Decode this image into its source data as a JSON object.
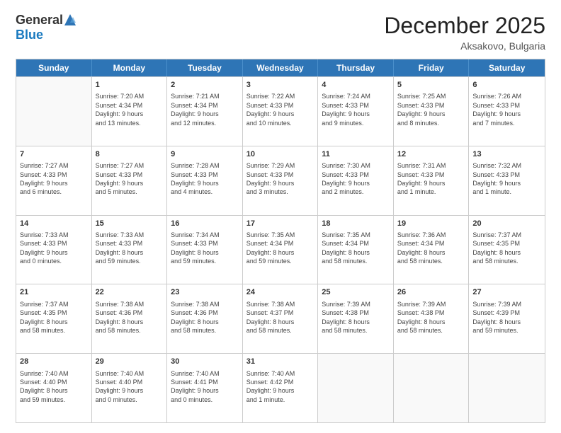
{
  "header": {
    "logo_general": "General",
    "logo_blue": "Blue",
    "month_title": "December 2025",
    "location": "Aksakovo, Bulgaria"
  },
  "weekdays": [
    "Sunday",
    "Monday",
    "Tuesday",
    "Wednesday",
    "Thursday",
    "Friday",
    "Saturday"
  ],
  "rows": [
    [
      {
        "day": "",
        "info": ""
      },
      {
        "day": "1",
        "info": "Sunrise: 7:20 AM\nSunset: 4:34 PM\nDaylight: 9 hours\nand 13 minutes."
      },
      {
        "day": "2",
        "info": "Sunrise: 7:21 AM\nSunset: 4:34 PM\nDaylight: 9 hours\nand 12 minutes."
      },
      {
        "day": "3",
        "info": "Sunrise: 7:22 AM\nSunset: 4:33 PM\nDaylight: 9 hours\nand 10 minutes."
      },
      {
        "day": "4",
        "info": "Sunrise: 7:24 AM\nSunset: 4:33 PM\nDaylight: 9 hours\nand 9 minutes."
      },
      {
        "day": "5",
        "info": "Sunrise: 7:25 AM\nSunset: 4:33 PM\nDaylight: 9 hours\nand 8 minutes."
      },
      {
        "day": "6",
        "info": "Sunrise: 7:26 AM\nSunset: 4:33 PM\nDaylight: 9 hours\nand 7 minutes."
      }
    ],
    [
      {
        "day": "7",
        "info": "Sunrise: 7:27 AM\nSunset: 4:33 PM\nDaylight: 9 hours\nand 6 minutes."
      },
      {
        "day": "8",
        "info": "Sunrise: 7:27 AM\nSunset: 4:33 PM\nDaylight: 9 hours\nand 5 minutes."
      },
      {
        "day": "9",
        "info": "Sunrise: 7:28 AM\nSunset: 4:33 PM\nDaylight: 9 hours\nand 4 minutes."
      },
      {
        "day": "10",
        "info": "Sunrise: 7:29 AM\nSunset: 4:33 PM\nDaylight: 9 hours\nand 3 minutes."
      },
      {
        "day": "11",
        "info": "Sunrise: 7:30 AM\nSunset: 4:33 PM\nDaylight: 9 hours\nand 2 minutes."
      },
      {
        "day": "12",
        "info": "Sunrise: 7:31 AM\nSunset: 4:33 PM\nDaylight: 9 hours\nand 1 minute."
      },
      {
        "day": "13",
        "info": "Sunrise: 7:32 AM\nSunset: 4:33 PM\nDaylight: 9 hours\nand 1 minute."
      }
    ],
    [
      {
        "day": "14",
        "info": "Sunrise: 7:33 AM\nSunset: 4:33 PM\nDaylight: 9 hours\nand 0 minutes."
      },
      {
        "day": "15",
        "info": "Sunrise: 7:33 AM\nSunset: 4:33 PM\nDaylight: 8 hours\nand 59 minutes."
      },
      {
        "day": "16",
        "info": "Sunrise: 7:34 AM\nSunset: 4:33 PM\nDaylight: 8 hours\nand 59 minutes."
      },
      {
        "day": "17",
        "info": "Sunrise: 7:35 AM\nSunset: 4:34 PM\nDaylight: 8 hours\nand 59 minutes."
      },
      {
        "day": "18",
        "info": "Sunrise: 7:35 AM\nSunset: 4:34 PM\nDaylight: 8 hours\nand 58 minutes."
      },
      {
        "day": "19",
        "info": "Sunrise: 7:36 AM\nSunset: 4:34 PM\nDaylight: 8 hours\nand 58 minutes."
      },
      {
        "day": "20",
        "info": "Sunrise: 7:37 AM\nSunset: 4:35 PM\nDaylight: 8 hours\nand 58 minutes."
      }
    ],
    [
      {
        "day": "21",
        "info": "Sunrise: 7:37 AM\nSunset: 4:35 PM\nDaylight: 8 hours\nand 58 minutes."
      },
      {
        "day": "22",
        "info": "Sunrise: 7:38 AM\nSunset: 4:36 PM\nDaylight: 8 hours\nand 58 minutes."
      },
      {
        "day": "23",
        "info": "Sunrise: 7:38 AM\nSunset: 4:36 PM\nDaylight: 8 hours\nand 58 minutes."
      },
      {
        "day": "24",
        "info": "Sunrise: 7:38 AM\nSunset: 4:37 PM\nDaylight: 8 hours\nand 58 minutes."
      },
      {
        "day": "25",
        "info": "Sunrise: 7:39 AM\nSunset: 4:38 PM\nDaylight: 8 hours\nand 58 minutes."
      },
      {
        "day": "26",
        "info": "Sunrise: 7:39 AM\nSunset: 4:38 PM\nDaylight: 8 hours\nand 58 minutes."
      },
      {
        "day": "27",
        "info": "Sunrise: 7:39 AM\nSunset: 4:39 PM\nDaylight: 8 hours\nand 59 minutes."
      }
    ],
    [
      {
        "day": "28",
        "info": "Sunrise: 7:40 AM\nSunset: 4:40 PM\nDaylight: 8 hours\nand 59 minutes."
      },
      {
        "day": "29",
        "info": "Sunrise: 7:40 AM\nSunset: 4:40 PM\nDaylight: 9 hours\nand 0 minutes."
      },
      {
        "day": "30",
        "info": "Sunrise: 7:40 AM\nSunset: 4:41 PM\nDaylight: 9 hours\nand 0 minutes."
      },
      {
        "day": "31",
        "info": "Sunrise: 7:40 AM\nSunset: 4:42 PM\nDaylight: 9 hours\nand 1 minute."
      },
      {
        "day": "",
        "info": ""
      },
      {
        "day": "",
        "info": ""
      },
      {
        "day": "",
        "info": ""
      }
    ]
  ]
}
